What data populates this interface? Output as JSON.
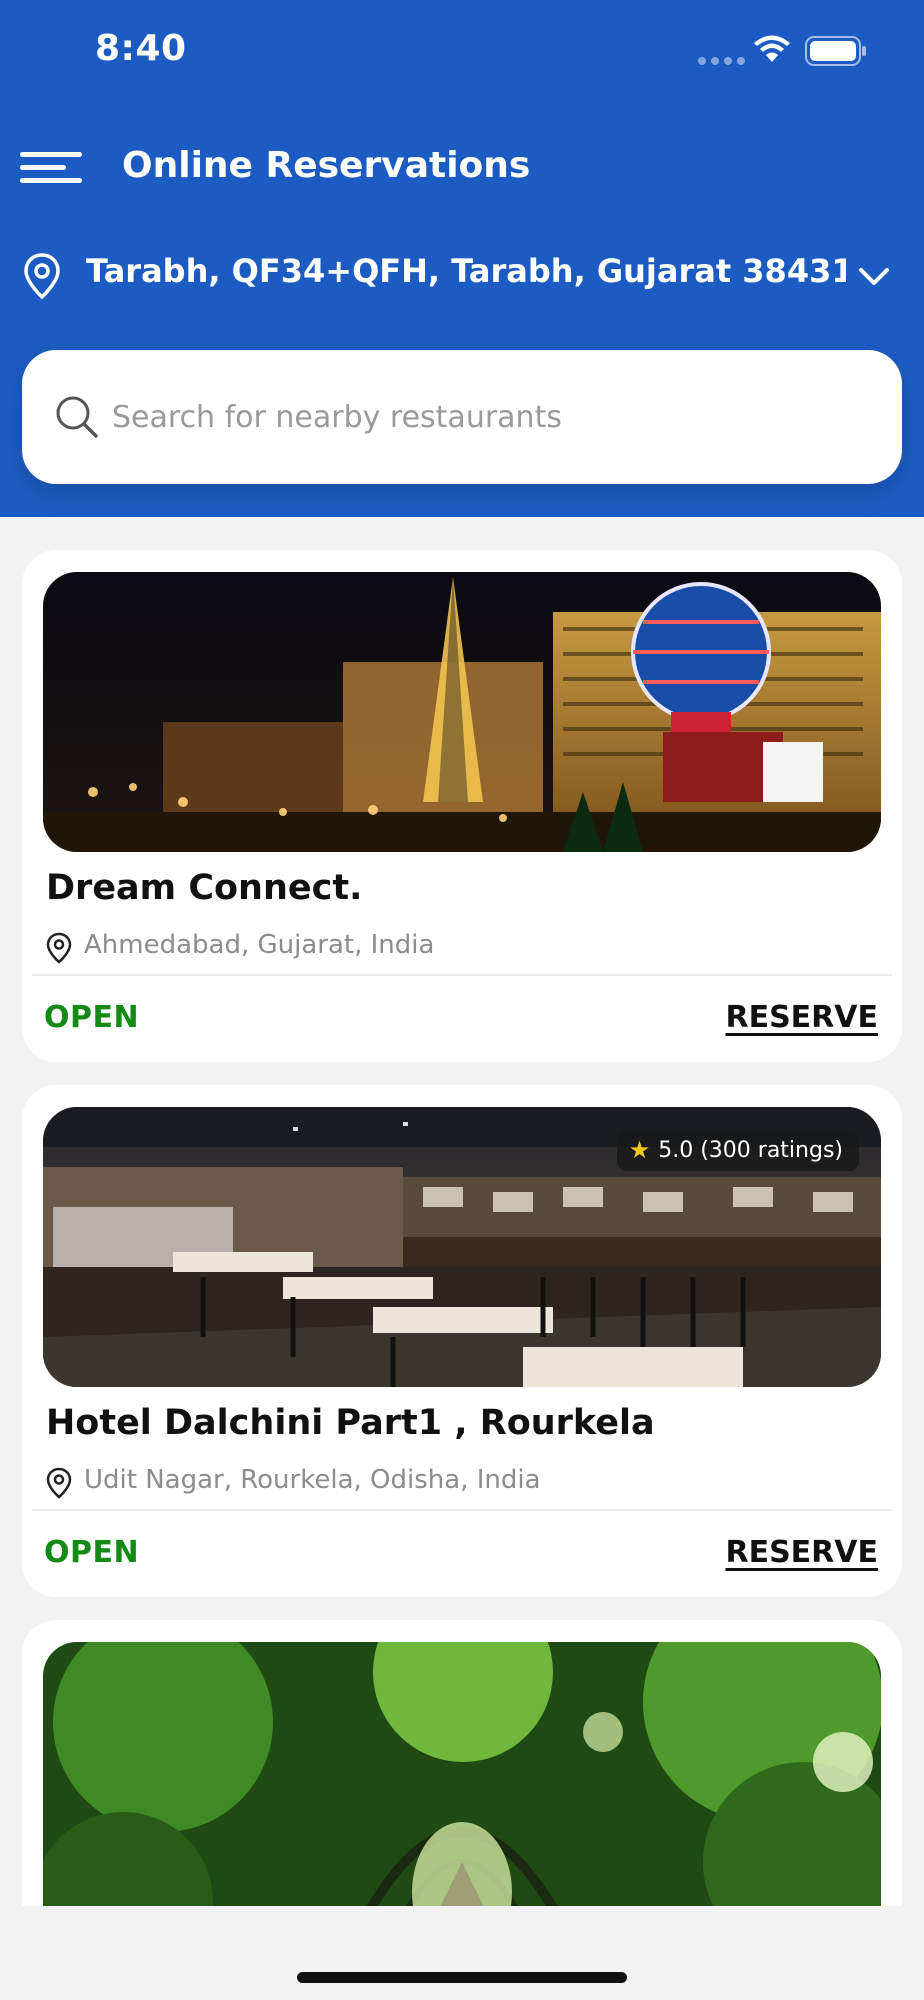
{
  "status_bar": {
    "time": "8:40"
  },
  "header": {
    "title": "Online Reservations",
    "location": "Tarabh, QF34+QFH, Tarabh, Gujarat 38431...",
    "color": "#1c5cc2"
  },
  "search": {
    "placeholder": "Search for nearby restaurants"
  },
  "restaurants": [
    {
      "name": "Dream Connect.",
      "address": "Ahmedabad, Gujarat, India",
      "status": "OPEN",
      "action": "RESERVE",
      "image": "night-city-photo"
    },
    {
      "name": "Hotel Dalchini Part1 , Rourkela",
      "address": "Udit Nagar, Rourkela, Odisha, India",
      "status": "OPEN",
      "action": "RESERVE",
      "rating": "5.0 (300 ratings)",
      "image": "cafe-interior-photo"
    },
    {
      "image": "garden-arch-photo"
    }
  ],
  "colors": {
    "open": "#138a13",
    "accent": "#1c5cc2"
  }
}
